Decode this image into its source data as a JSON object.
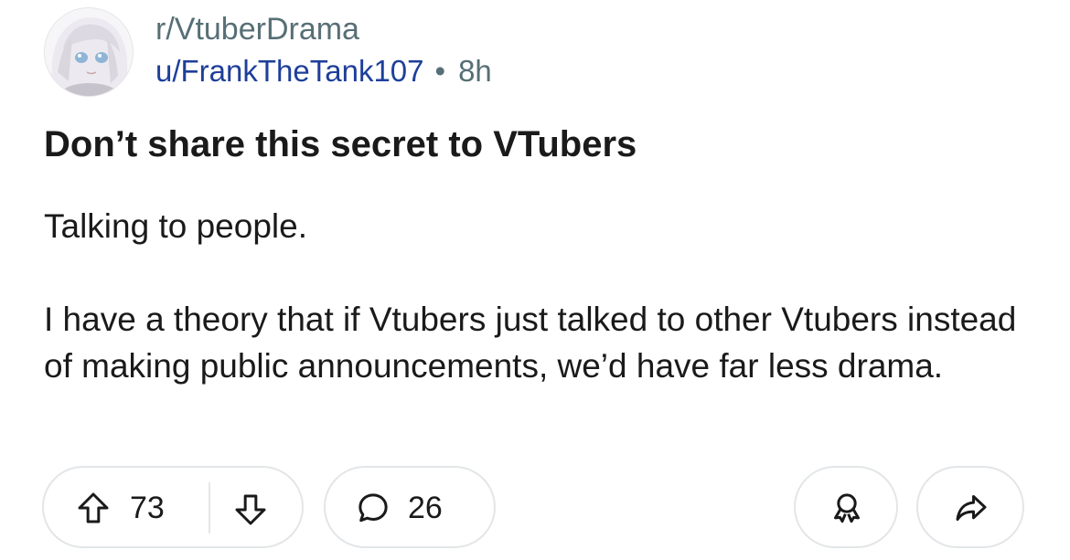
{
  "post": {
    "subreddit": "r/VtuberDrama",
    "author": "u/FrankTheTank107",
    "separator": "•",
    "time": "8h",
    "title": "Don’t share this secret to VTubers",
    "body": [
      "Talking to people.",
      "I have a theory that if Vtubers just talked to other Vtubers instead of making public announcements, we’d have far less drama."
    ]
  },
  "actions": {
    "upvotes": "73",
    "comments": "26"
  },
  "icons": {
    "upvote": "arrow-up-icon",
    "downvote": "arrow-down-icon",
    "comment": "comment-bubble-icon",
    "award": "award-icon",
    "share": "share-arrow-icon"
  },
  "colors": {
    "username": "#1e3f9a",
    "meta": "#576f76",
    "text": "#1a1a1b",
    "border": "#e3e6e8"
  }
}
